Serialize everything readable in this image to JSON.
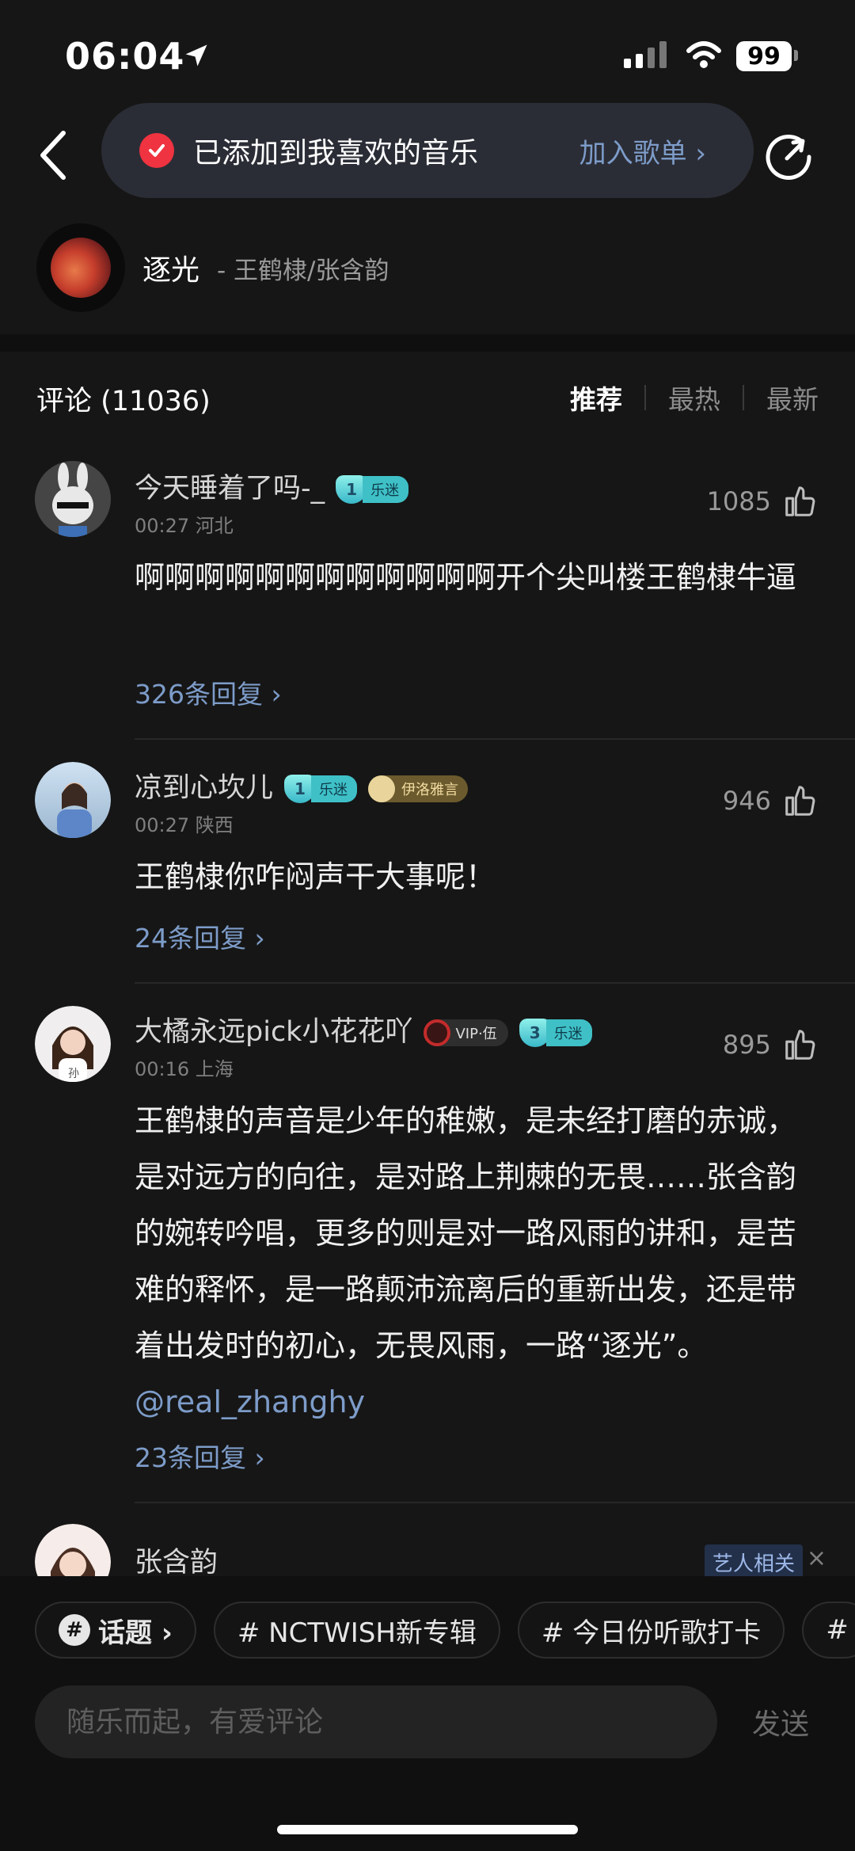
{
  "status_bar": {
    "time": "06:04",
    "battery": "99"
  },
  "toast": {
    "text": "已添加到我喜欢的音乐",
    "action": "加入歌单 ›"
  },
  "song": {
    "title": "逐光",
    "artist": "- 王鹤棣/张含韵"
  },
  "comments_header": {
    "title": "评论 (11036)",
    "tabs": [
      "推荐",
      "最热",
      "最新"
    ],
    "active_tab": "推荐"
  },
  "comments": [
    {
      "user": "今天睡着了吗-_",
      "badge": "1",
      "badge_label": "乐迷",
      "meta": "00:27 河北",
      "likes": "1085",
      "text": "啊啊啊啊啊啊啊啊啊啊啊啊开个尖叫楼王鹤棣牛逼",
      "replies": "326条回复 ›"
    },
    {
      "user": "凉到心坎儿",
      "badge": "1",
      "badge_label": "乐迷",
      "extra_badge": "伊洛雅言",
      "meta": "00:27 陕西",
      "likes": "946",
      "text": "王鹤棣你咋闷声干大事呢！",
      "replies": "24条回复 ›"
    },
    {
      "user": "大橘永远pick小花花吖",
      "vip": "VIP·伍",
      "badge": "3",
      "badge_label": "乐迷",
      "meta": "00:16 上海",
      "likes": "895",
      "text": "王鹤棣的声音是少年的稚嫩，是未经打磨的赤诚，是对远方的向往，是对路上荆棘的无畏……张含韵的婉转吟唱，更多的则是对一路风雨的讲和，是苦难的释怀，是一路颠沛流离后的重新出发，还是带着出发时的初心，无畏风雨，一路“逐光”。",
      "mention": "@real_zhanghy",
      "replies": "23条回复 ›"
    },
    {
      "user": "张含韵",
      "tag": "艺人相关",
      "close": "×"
    }
  ],
  "topics": {
    "label": "话题 ›",
    "items": [
      "# NCTWISH新专辑",
      "# 今日份听歌打卡",
      "#"
    ]
  },
  "input": {
    "placeholder": "随乐而起，有爱评论",
    "send": "发送"
  },
  "colors": {
    "background": "#161616",
    "link": "#7d9cc9",
    "toast_check": "#ef3340"
  },
  "icons": [
    "location-arrow-icon",
    "signal-icon",
    "wifi-icon",
    "back-icon",
    "check-icon",
    "share-icon",
    "thumbs-up-icon",
    "hash-icon"
  ]
}
